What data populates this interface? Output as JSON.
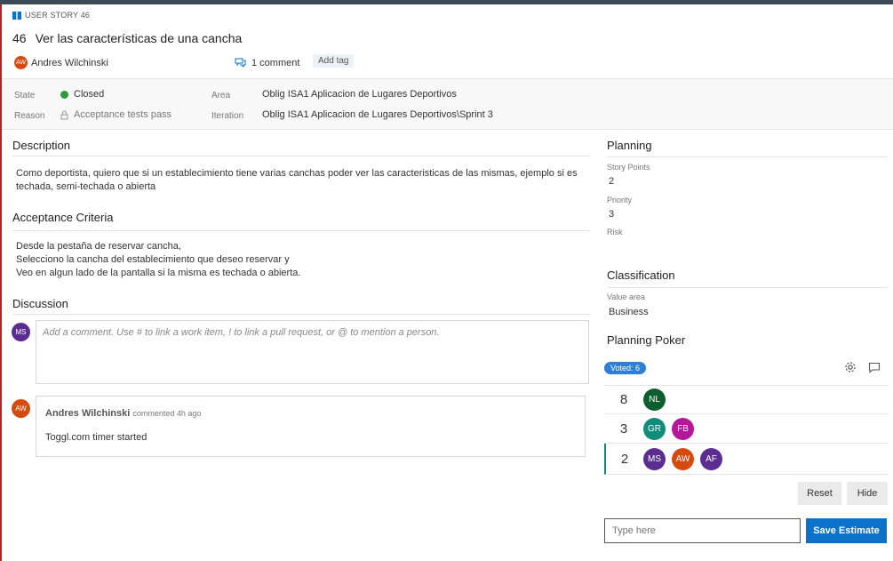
{
  "header": {
    "type_label": "USER STORY 46",
    "id": "46",
    "title": "Ver las características de una cancha",
    "assignee": {
      "initials": "AW",
      "name": "Andres Wilchinski",
      "color": "#d64a0f"
    },
    "comments_label": "1 comment",
    "add_tag_label": "Add tag"
  },
  "state_fields": {
    "state_label": "State",
    "state_value": "Closed",
    "state_color": "#2e9a3a",
    "reason_label": "Reason",
    "reason_value": "Acceptance tests pass",
    "area_label": "Area",
    "area_value": "Oblig ISA1 Aplicacion de Lugares Deportivos",
    "iteration_label": "Iteration",
    "iteration_value": "Oblig ISA1 Aplicacion de Lugares Deportivos\\Sprint 3"
  },
  "description": {
    "title": "Description",
    "text": "Como deportista, quiero que si un establecimiento tiene varias canchas poder ver las caracteristicas de las mismas, ejemplo si es techada, semi-techada o abierta"
  },
  "acceptance": {
    "title": "Acceptance Criteria",
    "lines": [
      "Desde la pestaña de reservar cancha,",
      "Selecciono la cancha del establecimiento que deseo reservar y",
      "Veo en algun lado de la pantalla si la misma es techada o abierta."
    ]
  },
  "discussion": {
    "title": "Discussion",
    "current_user": {
      "initials": "MS",
      "color": "#5c2d91"
    },
    "placeholder": "Add a comment. Use # to link a work item, ! to link a pull request, or @ to mention a person.",
    "comments": [
      {
        "author": "Andres Wilchinski",
        "meta": "commented 4h ago",
        "text": "Toggl.com timer started",
        "initials": "AW",
        "color": "#d64a0f"
      }
    ]
  },
  "planning": {
    "title": "Planning",
    "story_points_label": "Story Points",
    "story_points_value": "2",
    "priority_label": "Priority",
    "priority_value": "3",
    "risk_label": "Risk"
  },
  "classification": {
    "title": "Classification",
    "value_area_label": "Value area",
    "value_area_value": "Business"
  },
  "poker": {
    "title": "Planning Poker",
    "voted_badge": "Voted: 6",
    "rows": [
      {
        "value": "8",
        "voters": [
          {
            "initials": "NL",
            "color": "#0d5e2f"
          }
        ]
      },
      {
        "value": "3",
        "voters": [
          {
            "initials": "GR",
            "color": "#108c7a"
          },
          {
            "initials": "FB",
            "color": "#b4179a"
          }
        ]
      },
      {
        "value": "2",
        "voters": [
          {
            "initials": "MS",
            "color": "#5c2d91"
          },
          {
            "initials": "AW",
            "color": "#d64a0f"
          },
          {
            "initials": "AF",
            "color": "#5c2d91"
          }
        ]
      }
    ],
    "reset_label": "Reset",
    "hide_label": "Hide",
    "input_placeholder": "Type here",
    "save_label": "Save Estimate"
  },
  "colors": {
    "accent": "#0a72c8",
    "badge": "#2f7fd6"
  }
}
